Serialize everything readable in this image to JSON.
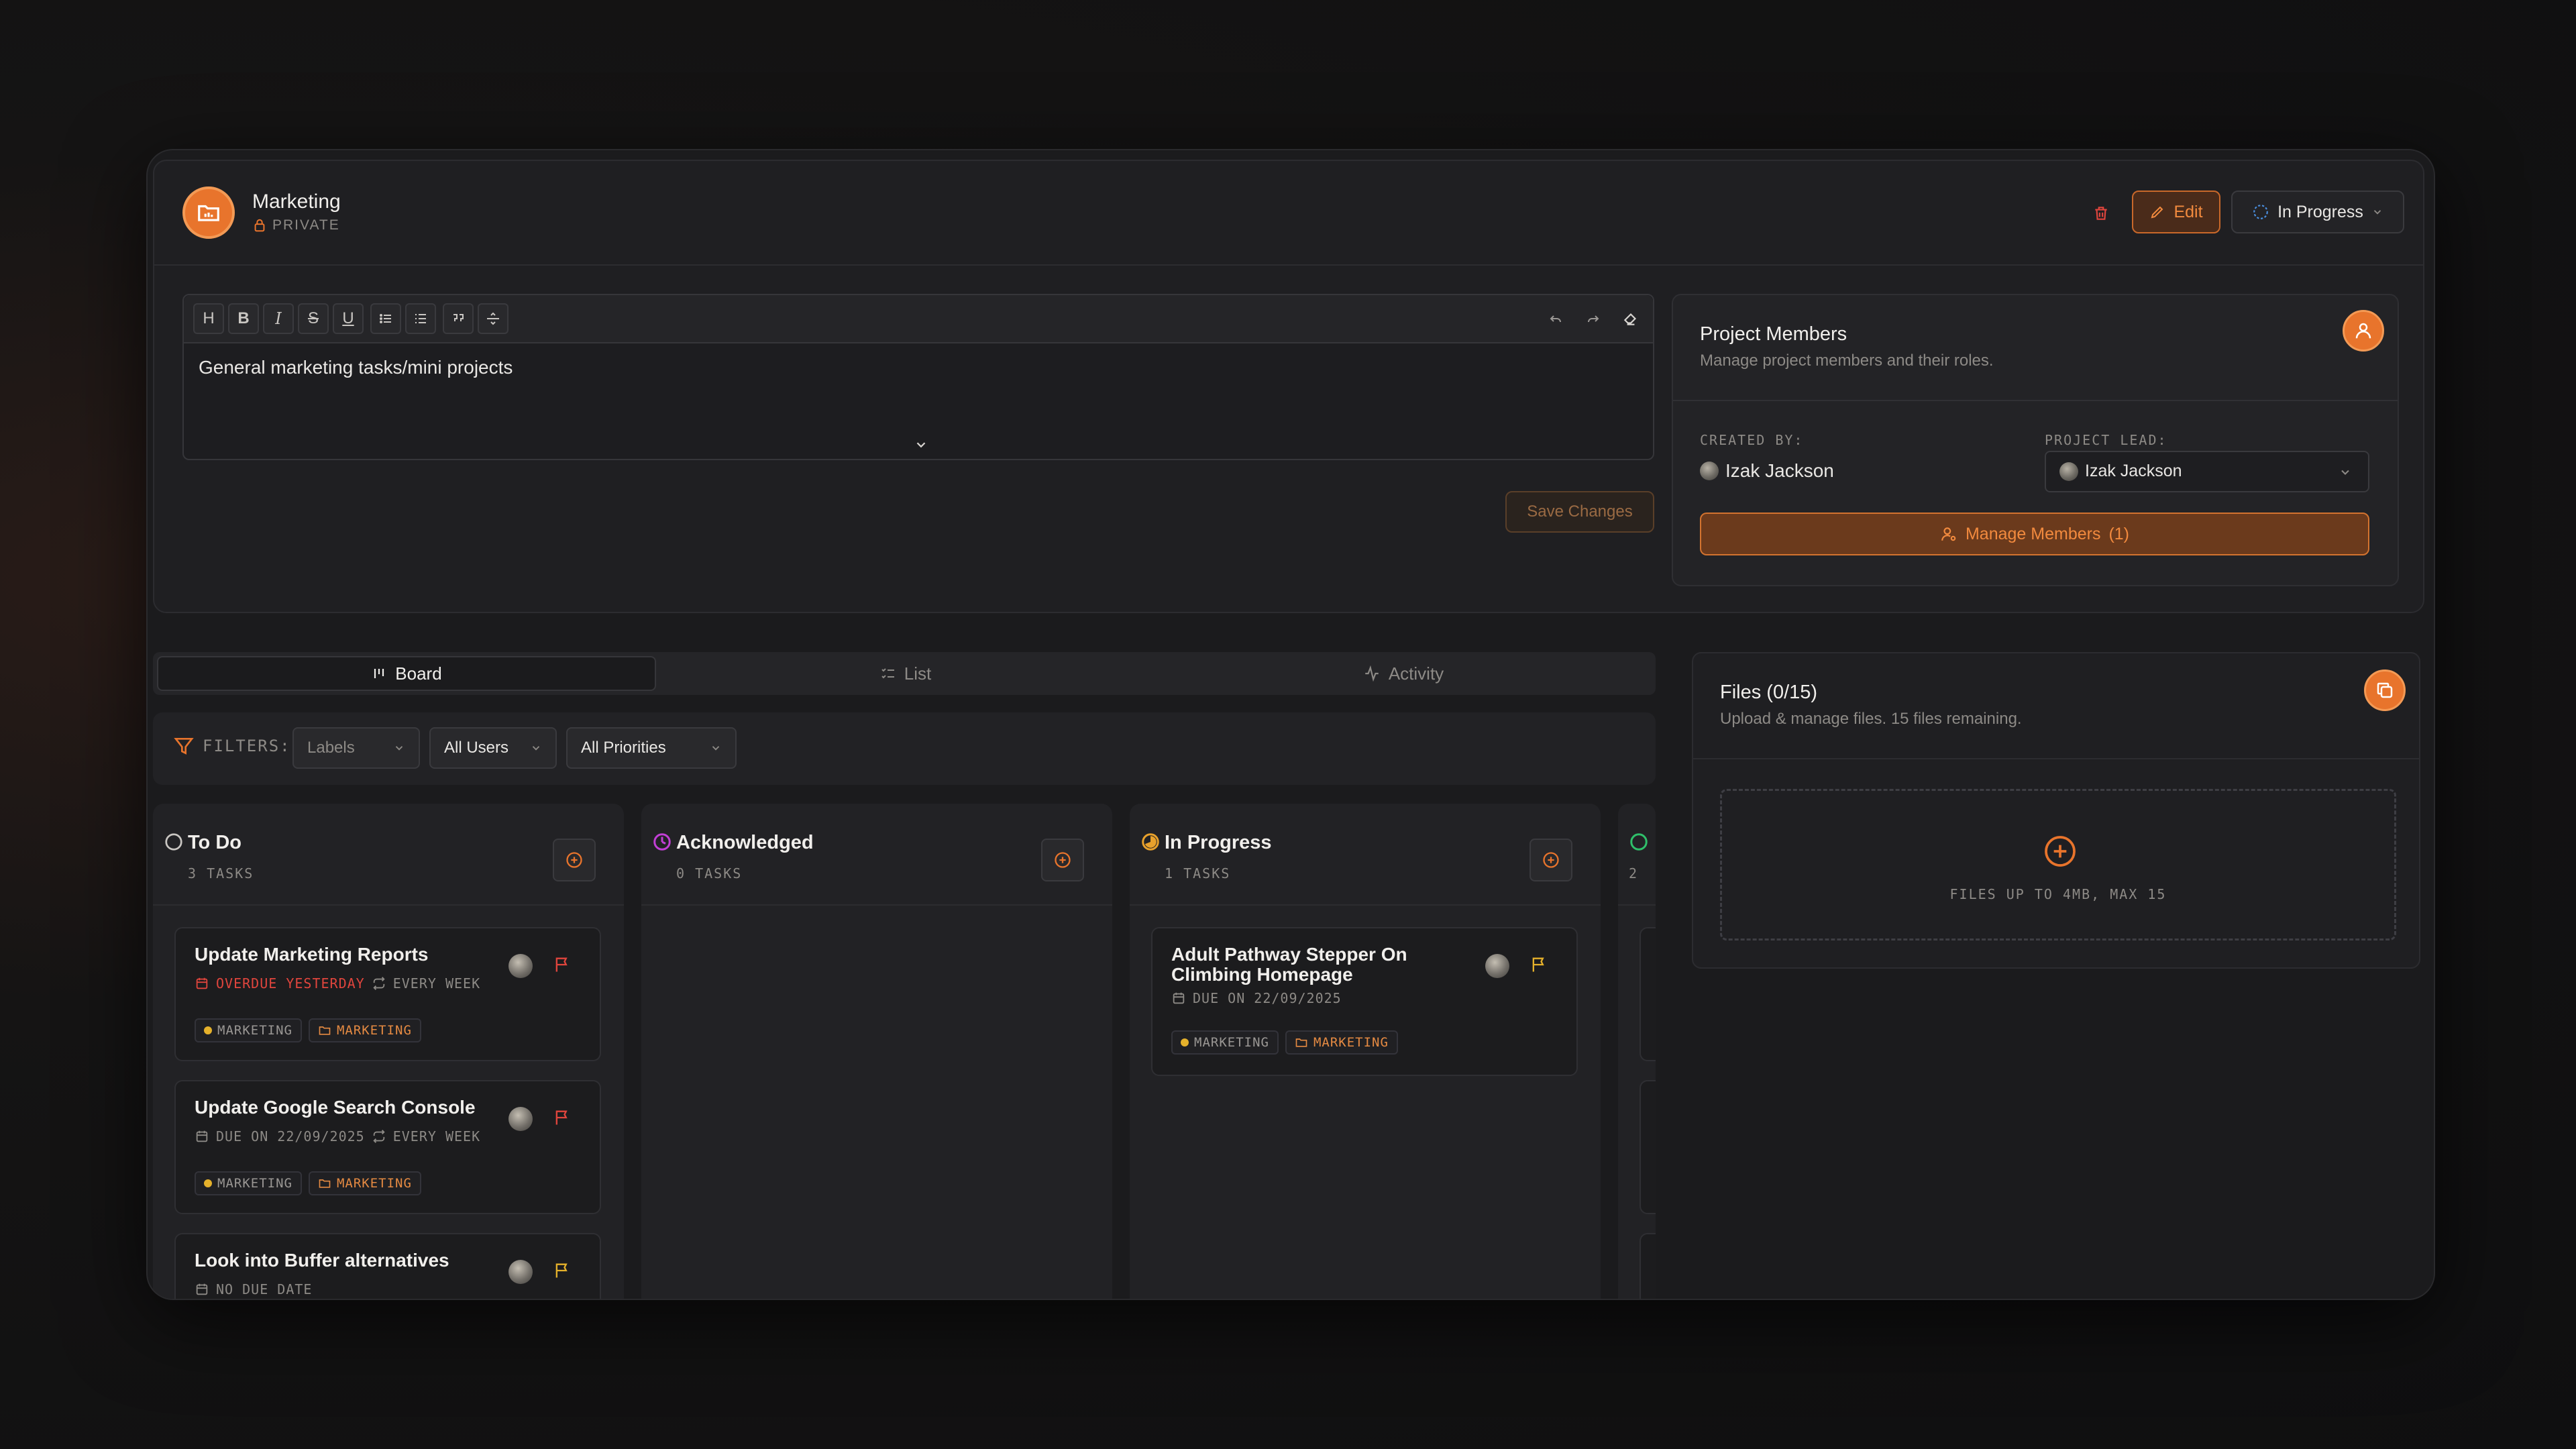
{
  "project": {
    "name": "Marketing",
    "visibility": "PRIVATE",
    "edit_label": "Edit",
    "status_label": "In Progress"
  },
  "editor": {
    "toolbar": [
      "H",
      "B",
      "I",
      "S",
      "U",
      "bullet-list",
      "ordered-list",
      "quote",
      "divider"
    ],
    "content": "General marketing tasks/mini projects",
    "save_label": "Save Changes"
  },
  "members": {
    "title": "Project Members",
    "subtitle": "Manage project members and their roles.",
    "created_by_label": "CREATED BY:",
    "created_by": "Izak Jackson",
    "project_lead_label": "PROJECT LEAD:",
    "project_lead": "Izak Jackson",
    "manage_label": "Manage Members",
    "manage_count": "(1)"
  },
  "tabs": [
    {
      "label": "Board",
      "active": true
    },
    {
      "label": "List",
      "active": false
    },
    {
      "label": "Activity",
      "active": false
    }
  ],
  "filters": {
    "label": "FILTERS:",
    "labels": "Labels",
    "users": "All Users",
    "priorities": "All Priorities"
  },
  "columns": [
    {
      "title": "To Do",
      "count": "3 TASKS",
      "cards": [
        {
          "title": "Update Marketing Reports",
          "due": "OVERDUE YESTERDAY",
          "overdue": true,
          "repeat": "EVERY WEEK",
          "tags": [
            "MARKETING",
            "MARKETING"
          ]
        },
        {
          "title": "Update Google Search Console",
          "due": "DUE ON 22/09/2025",
          "overdue": false,
          "repeat": "EVERY WEEK",
          "tags": [
            "MARKETING",
            "MARKETING"
          ]
        },
        {
          "title": "Look into Buffer alternatives",
          "due": "NO DUE DATE",
          "overdue": false,
          "repeat": "",
          "tags": []
        }
      ]
    },
    {
      "title": "Acknowledged",
      "count": "0 TASKS",
      "cards": []
    },
    {
      "title": "In Progress",
      "count": "1 TASKS",
      "cards": [
        {
          "title": "Adult Pathway Stepper On Climbing Homepage",
          "due": "DUE ON 22/09/2025",
          "overdue": false,
          "repeat": "",
          "tags": [
            "MARKETING",
            "MARKETING"
          ]
        }
      ]
    },
    {
      "title": "",
      "count": "2",
      "cards": []
    }
  ],
  "files": {
    "title": "Files (0/15)",
    "subtitle": "Upload & manage files. 15 files remaining.",
    "drop_label": "FILES UP TO 4MB, MAX 15"
  },
  "colors": {
    "accent": "#e8742c",
    "danger": "#e0453d",
    "acknowledged": "#c23fd6",
    "in_progress": "#e8a12c",
    "done": "#2fbf6a"
  }
}
